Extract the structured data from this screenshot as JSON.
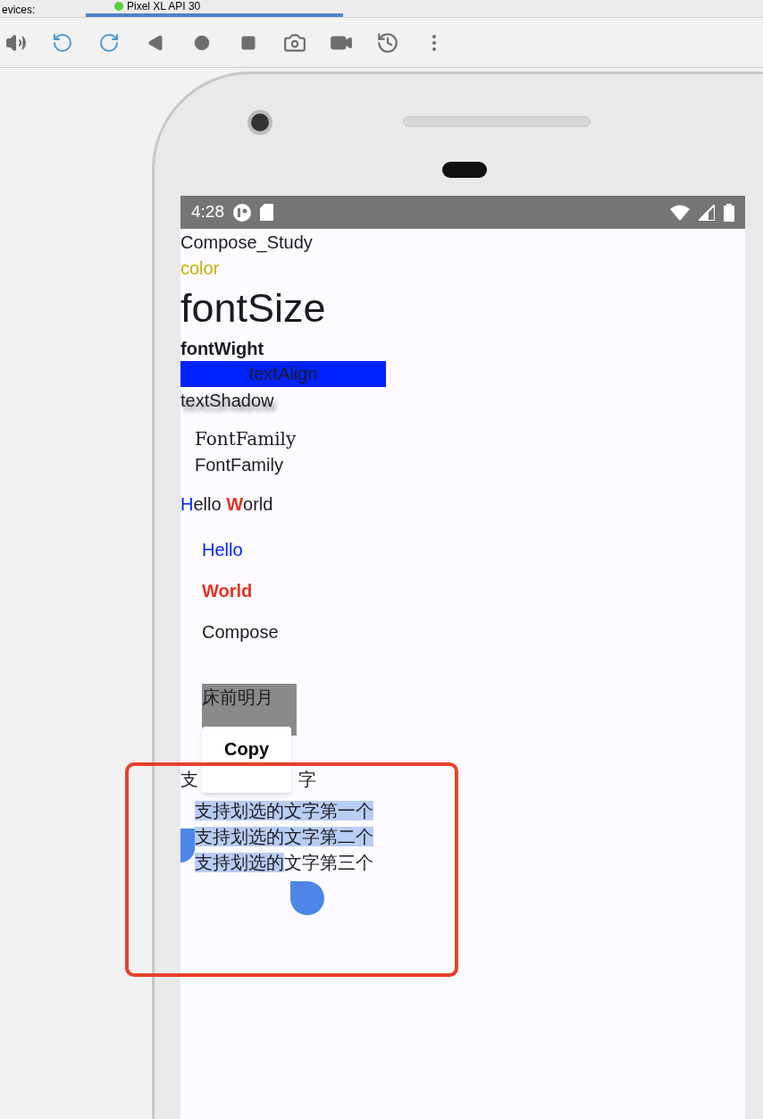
{
  "top_bar": {
    "label": "evices:",
    "device_tab": {
      "label": "Pixel XL API 30",
      "selected": true
    }
  },
  "status_bar": {
    "time": "4:28"
  },
  "app": {
    "title": "Compose_Study",
    "color_text": "color",
    "font_size_text": "fontSize",
    "font_weight_text": "fontWight",
    "text_align_text": "textAlign",
    "text_shadow_text": "textShadow",
    "font_family_texts": [
      {
        "text": "FontFamily",
        "kind": "serif"
      },
      {
        "text": "FontFamily",
        "kind": "sans"
      }
    ],
    "span_line": [
      {
        "text": "H",
        "color": "#0022ff",
        "bold": false
      },
      {
        "text": "ello ",
        "color": "#1c1b1f",
        "bold": false
      },
      {
        "text": "W",
        "color": "#e53222",
        "bold": true
      },
      {
        "text": "orld",
        "color": "#1c1b1f",
        "bold": false
      }
    ],
    "column_items": [
      {
        "text": "Hello",
        "color": "#0022ff",
        "bold": false
      },
      {
        "text": "World",
        "color": "#e53222",
        "bold": true
      },
      {
        "text": "Compose",
        "color": "#1c1b1f",
        "bold": false
      }
    ],
    "poem_box": {
      "line": "床前明月"
    },
    "copy_menu": {
      "label": "Copy"
    },
    "partial_line": [
      "支",
      "字"
    ],
    "selectable_lines": [
      {
        "segments": [
          {
            "text": "支持划选的文字第一个",
            "selected": true
          }
        ]
      },
      {
        "segments": [
          {
            "text": "支持划选的文字第二个",
            "selected": true
          }
        ]
      },
      {
        "segments": [
          {
            "text": "支持划选的",
            "selected": true
          },
          {
            "text": "文字第三个",
            "selected": false
          }
        ]
      }
    ]
  }
}
